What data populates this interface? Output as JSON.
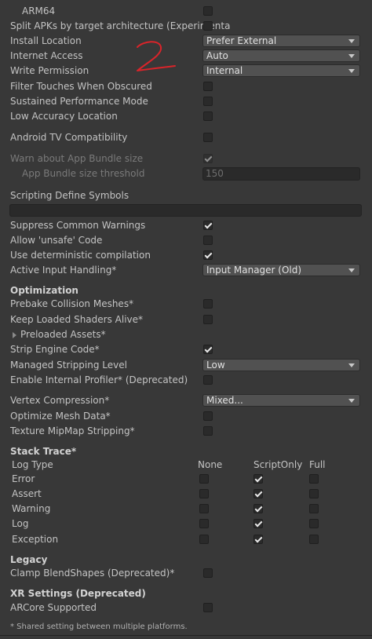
{
  "rows": {
    "arm64": "ARM64",
    "split_apks": "Split APKs by target architecture (Experimenta",
    "install_location": {
      "label": "Install Location",
      "value": "Prefer External"
    },
    "internet_access": {
      "label": "Internet Access",
      "value": "Auto"
    },
    "write_permission": {
      "label": "Write Permission",
      "value": "Internal"
    },
    "filter_touches": "Filter Touches When Obscured",
    "sustained_performance": "Sustained Performance Mode",
    "low_accuracy_location": "Low Accuracy Location",
    "android_tv": "Android TV Compatibility",
    "warn_app_bundle": "Warn about App Bundle size",
    "app_bundle_threshold": {
      "label": "App Bundle size threshold",
      "value": "150"
    },
    "scripting_define_symbols": "Scripting Define Symbols",
    "suppress_warnings": "Suppress Common Warnings",
    "allow_unsafe": "Allow 'unsafe' Code",
    "deterministic": "Use deterministic compilation",
    "active_input": {
      "label": "Active Input Handling*",
      "value": "Input Manager (Old)"
    },
    "optimization_header": "Optimization",
    "prebake_collision": "Prebake Collision Meshes*",
    "keep_shaders": "Keep Loaded Shaders Alive*",
    "preloaded_assets": "Preloaded Assets*",
    "strip_engine": "Strip Engine Code*",
    "managed_stripping": {
      "label": "Managed Stripping Level",
      "value": "Low"
    },
    "internal_profiler": "Enable Internal Profiler* (Deprecated)",
    "vertex_compression": {
      "label": "Vertex Compression*",
      "value": "Mixed..."
    },
    "optimize_mesh": "Optimize Mesh Data*",
    "texture_mipmap": "Texture MipMap Stripping*",
    "stack_trace_header": "Stack Trace*",
    "legacy_header": "Legacy",
    "clamp_blendshapes": "Clamp BlendShapes (Deprecated)*",
    "xr_header": "XR Settings (Deprecated)",
    "arcore": "ARCore Supported"
  },
  "stack_trace": {
    "col_log_type": "Log Type",
    "col_none": "None",
    "col_scriptonly": "ScriptOnly",
    "col_full": "Full",
    "rows": [
      {
        "label": "Error",
        "none": false,
        "scriptonly": true,
        "full": false
      },
      {
        "label": "Assert",
        "none": false,
        "scriptonly": true,
        "full": false
      },
      {
        "label": "Warning",
        "none": false,
        "scriptonly": true,
        "full": false
      },
      {
        "label": "Log",
        "none": false,
        "scriptonly": true,
        "full": false
      },
      {
        "label": "Exception",
        "none": false,
        "scriptonly": true,
        "full": false
      }
    ]
  },
  "footer": "* Shared setting between multiple platforms.",
  "annotation_color": "#d9242a",
  "checkbox_checked_color": "#e8e8e8"
}
